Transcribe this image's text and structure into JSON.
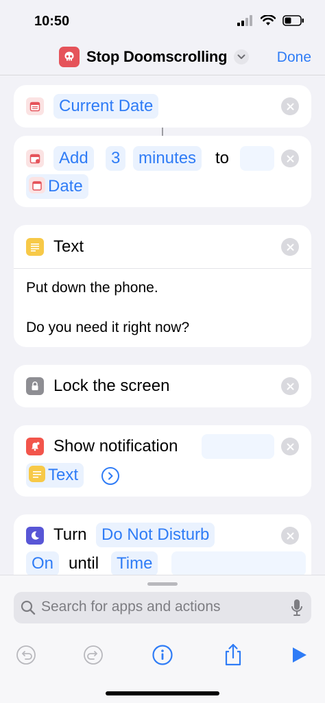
{
  "status": {
    "time": "10:50"
  },
  "nav": {
    "title": "Stop Doomscrolling",
    "done": "Done"
  },
  "actions": {
    "current_date": {
      "label": "Current Date"
    },
    "add": {
      "verb": "Add",
      "amount": "3",
      "unit": "minutes",
      "to": "to",
      "date": "Date"
    },
    "text": {
      "title": "Text",
      "line1": "Put down the phone.",
      "line2": "Do you need it right now?"
    },
    "lock": {
      "title": "Lock the screen"
    },
    "notify": {
      "title": "Show notification",
      "param": "Text"
    },
    "dnd": {
      "verb": "Turn",
      "mode": "Do Not Disturb",
      "state": "On",
      "until": "until",
      "time": "Time"
    }
  },
  "search": {
    "placeholder": "Search for apps and actions"
  },
  "colors": {
    "accent": "#2f7cf6",
    "app_icon": "#e5535a",
    "calendar_icon": "#e5535a",
    "text_icon": "#f7c948",
    "lock_icon": "#8e8e93",
    "notification_icon": "#f2554b",
    "dnd_icon": "#5856d6"
  },
  "icons": [
    "skull-icon",
    "chevron-down-icon",
    "calendar-icon",
    "text-lines-icon",
    "lock-icon",
    "bell-icon",
    "moon-icon",
    "search-icon",
    "microphone-icon",
    "undo-icon",
    "redo-icon",
    "info-icon",
    "share-icon",
    "play-icon",
    "close-icon"
  ]
}
